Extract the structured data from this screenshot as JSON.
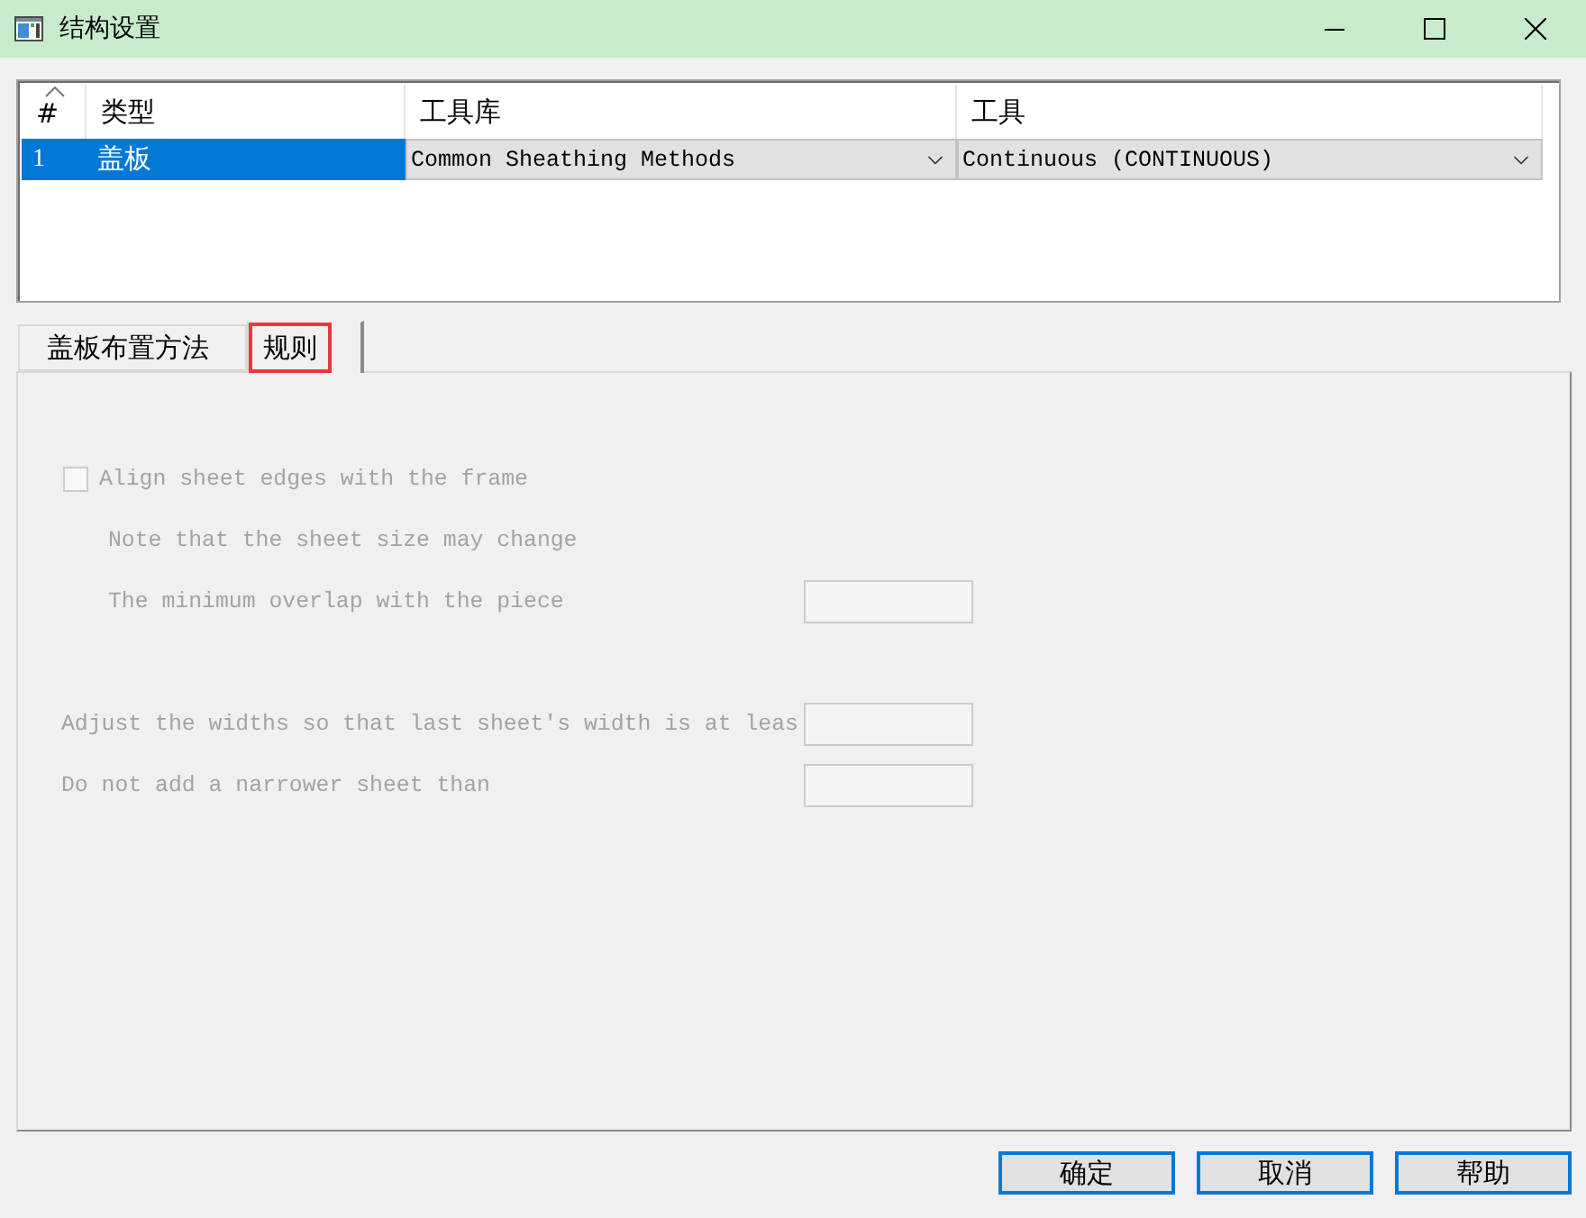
{
  "window": {
    "title": "结构设置"
  },
  "grid": {
    "columns": [
      {
        "label": "#",
        "sorted": true
      },
      {
        "label": "类型",
        "sorted": false
      },
      {
        "label": "工具库",
        "sorted": false
      },
      {
        "label": "工具",
        "sorted": false
      }
    ],
    "rows": [
      {
        "number": "1",
        "type": "盖板",
        "library": "Common Sheathing Methods",
        "tool": "Continuous (CONTINUOUS)",
        "selected": true
      }
    ]
  },
  "tabs": [
    {
      "label": "盖板布置方法",
      "selected": false,
      "highlighted": false
    },
    {
      "label": "规则",
      "selected": true,
      "highlighted": true
    }
  ],
  "rules": [
    {
      "kind": "checkbox",
      "label": "Align sheet edges with the frame",
      "checked": false,
      "disabled": true,
      "children": [
        {
          "kind": "note",
          "label": "Note that the sheet size may change",
          "disabled": true
        },
        {
          "kind": "field",
          "label": "The minimum overlap with the piece",
          "disabled": true
        }
      ]
    },
    {
      "kind": "field",
      "label": "Adjust the widths so that last sheet's width is at leas",
      "disabled": true
    },
    {
      "kind": "field",
      "label": "Do not add a narrower sheet than",
      "disabled": true
    }
  ],
  "buttons": [
    "确定",
    "取消",
    "帮助"
  ]
}
